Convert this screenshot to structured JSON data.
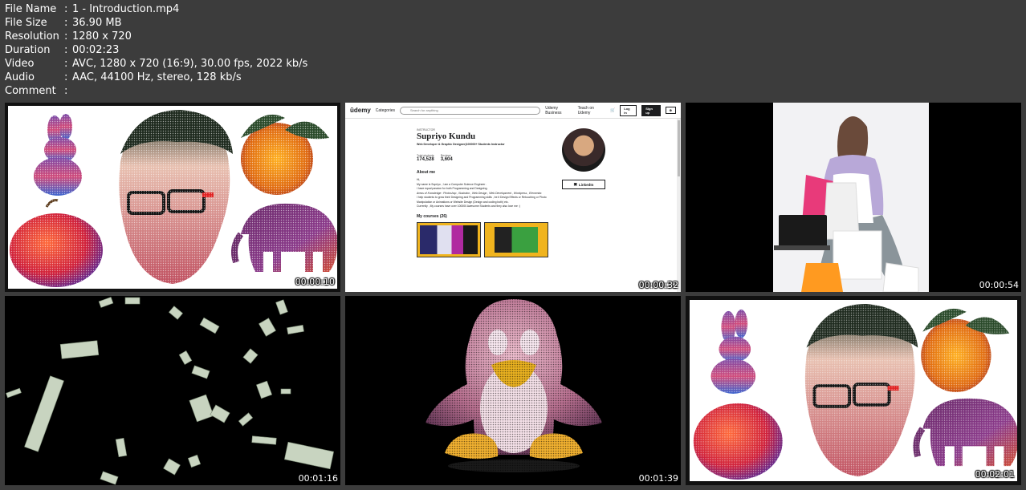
{
  "meta": {
    "rows": [
      {
        "key": "File Name",
        "sep": ":",
        "value": "1 - Introduction.mp4"
      },
      {
        "key": "File Size",
        "sep": ":",
        "value": "36.90 MB"
      },
      {
        "key": "Resolution",
        "sep": ":",
        "value": "1280 x 720"
      },
      {
        "key": "Duration",
        "sep": ":",
        "value": "00:02:23"
      },
      {
        "key": "Video",
        "sep": ":",
        "value": "AVC, 1280 x 720 (16:9), 30.00 fps, 2022 kb/s"
      },
      {
        "key": "Audio",
        "sep": ":",
        "value": "AAC, 44100 Hz, stereo, 128 kb/s"
      },
      {
        "key": "Comment",
        "sep": ":",
        "value": ""
      }
    ]
  },
  "thumbs": [
    {
      "time": "00:00:10"
    },
    {
      "time": "00:00:32"
    },
    {
      "time": "00:00:54"
    },
    {
      "time": "00:01:16"
    },
    {
      "time": "00:01:39"
    },
    {
      "time": "00:02:01"
    }
  ],
  "udemy": {
    "logo": "ūdemy",
    "categories": "Categories",
    "search_placeholder": "Search for anything",
    "business": "Udemy Business",
    "teach": "Teach on Udemy",
    "login": "Log in",
    "signup": "Sign up",
    "eyebrow": "INSTRUCTOR",
    "name": "Supriyo Kundu",
    "headline": "Web Developer & Graphic Designer|100000+ Students Instructor",
    "stat1_label": "Total students",
    "stat1_value": "174,528",
    "stat2_label": "Reviews",
    "stat2_value": "3,604",
    "about": "About me",
    "bio1": "Hi,",
    "bio2": "My name is Supriyo , I am a Computer Science Engineer .",
    "bio3": "I have equal passion for both Programming and Designing.",
    "bio4": "Areas of Knowledge : Photoshop , Illustrator , Web Design , Web Development , Wordpress , Elementor.",
    "bio5": "I help students to grow their Designing and Programming skills , be it Design Effects or Retouching or Photo Manipulation or Animations or Website Design (Design and coding both) etc.",
    "bio6": "Currently , My courses have over 100000 Awesome Students and they also love me :)",
    "courses": "My courses (26)",
    "linkedin": "LinkedIn"
  },
  "colors": {
    "background": "#3c3c3c",
    "text": "#ffffff",
    "udemy_course_frame": "#f0b41e"
  }
}
